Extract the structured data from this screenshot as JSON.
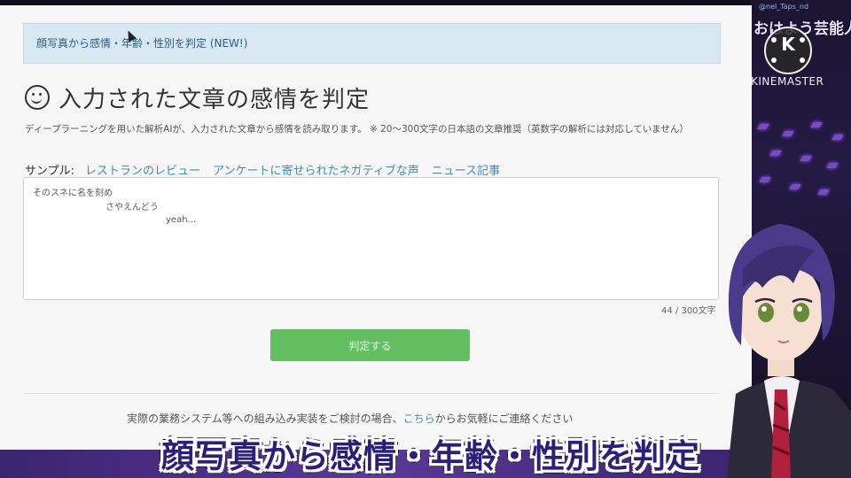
{
  "notice": {
    "text": "顔写真から感情・年齢・性別を判定 (NEW!)"
  },
  "page": {
    "title": "入力された文章の感情を判定",
    "description": "ディープラーニングを用いた解析AIが、入力された文章から感情を読み取ります。 ※ 20〜300文字の日本語の文章推奨（英数字の解析には対応していません）",
    "samples_label": "サンプル:",
    "samples": [
      "レストランのレビュー",
      "アンケートに寄せられたネガティブな声",
      "ニュース記事"
    ],
    "textarea_lines": [
      "そのスネに名を刻め",
      "さやえんどう",
      "yeah..."
    ],
    "counter": "44 / 300文字",
    "submit_label": "判定する",
    "footer_prefix": "実際の業務システム等への組み込み実装をご検討の場合、",
    "footer_link": "こちら",
    "footer_suffix": "からお気軽にご連絡ください"
  },
  "caption": "顔写真から感情・年齢・性別を判定",
  "overlay": {
    "channel_handle": "@nel_Taps_nd",
    "channel_logo": "おはよう芸能人",
    "kinemaster_letter": "K",
    "kinemaster_text": "KINEMASTER"
  },
  "colors": {
    "notice_bg": "#d7e8f2",
    "link": "#3b8dbd",
    "button": "#62bf60",
    "caption": "#2a1f7a",
    "strip": "#5a3898"
  }
}
